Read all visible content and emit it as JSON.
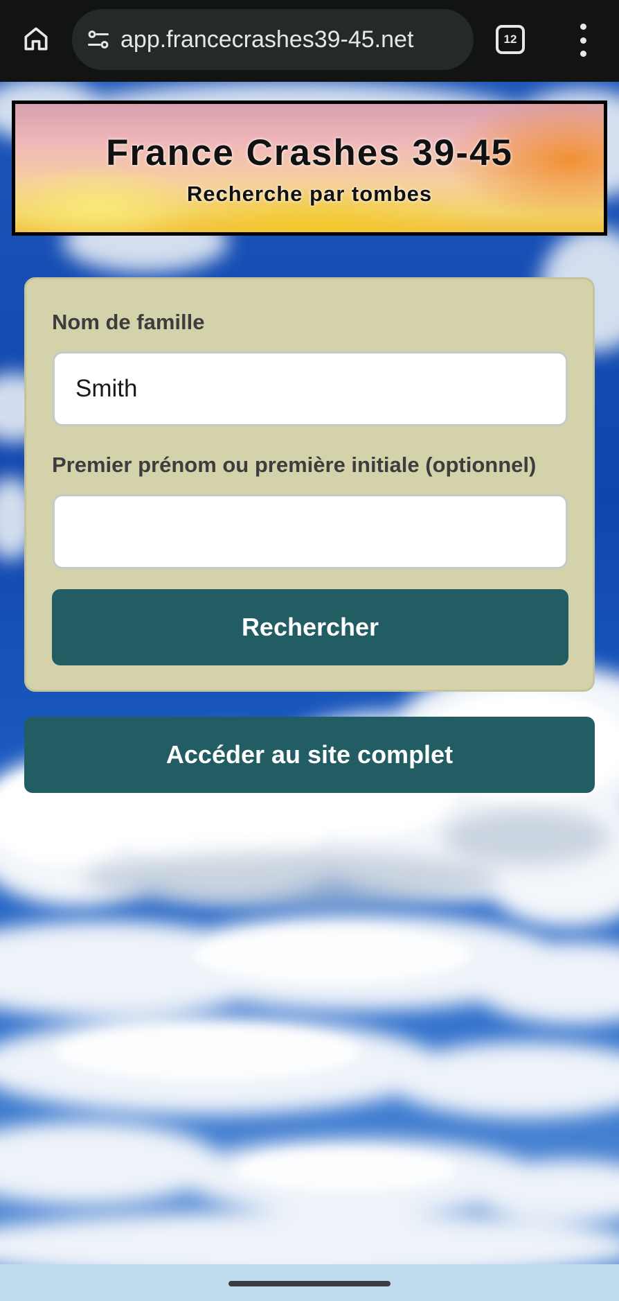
{
  "browser": {
    "url": "app.francecrashes39-45.net",
    "tab_count": "12",
    "icons": {
      "home": "home-icon",
      "site_info": "site-settings-icon",
      "menu": "more-vert-icon"
    }
  },
  "banner": {
    "title": "France Crashes 39-45",
    "subtitle": "Recherche par tombes"
  },
  "search_form": {
    "surname_label": "Nom de famille",
    "surname_value": "Smith",
    "firstname_label": "Premier prénom ou première initiale (optionnel)",
    "firstname_value": "",
    "submit_label": "Rechercher"
  },
  "full_site": {
    "label": "Accéder au site complet"
  },
  "colors": {
    "button": "#215d63",
    "card": "#d3d2ab",
    "sky": "#1a4fb5",
    "browser_bar": "#121414"
  }
}
